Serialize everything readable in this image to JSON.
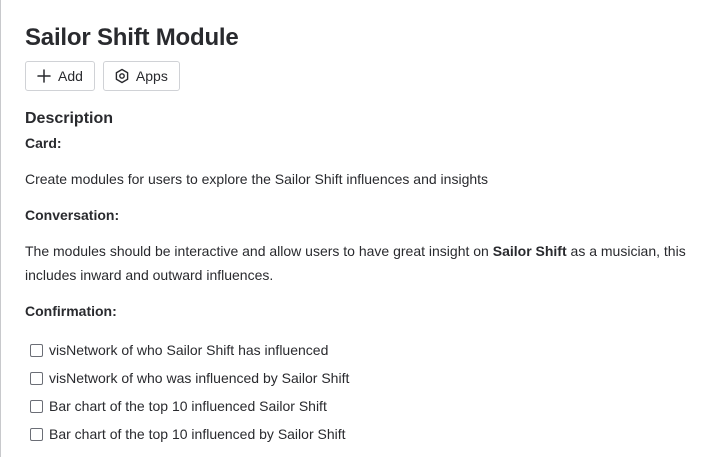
{
  "page": {
    "title": "Sailor Shift Module"
  },
  "toolbar": {
    "add_label": "Add",
    "add_icon": "plus-icon",
    "apps_label": "Apps",
    "apps_icon": "apps-hexagon-icon"
  },
  "description": {
    "heading": "Description",
    "card_label": "Card:",
    "card_text": "Create modules for users to explore the Sailor Shift influences and insights",
    "conversation_label": "Conversation:",
    "conversation_text_before": "The modules should be interactive and allow users to have great insight on ",
    "conversation_text_bold": "Sailor Shift",
    "conversation_text_after": " as a musician, this includes inward and outward influences.",
    "confirmation_label": "Confirmation:",
    "checklist": [
      {
        "label": "visNetwork of who Sailor Shift has influenced",
        "checked": false
      },
      {
        "label": "visNetwork of who was influenced by Sailor Shift",
        "checked": false
      },
      {
        "label": "Bar chart of the top 10 influenced Sailor Shift",
        "checked": false
      },
      {
        "label": "Bar chart of the top 10 influenced by Sailor Shift",
        "checked": false
      }
    ]
  },
  "colors": {
    "text": "#292a2e",
    "border": "#d0d2d6",
    "background": "#ffffff"
  }
}
